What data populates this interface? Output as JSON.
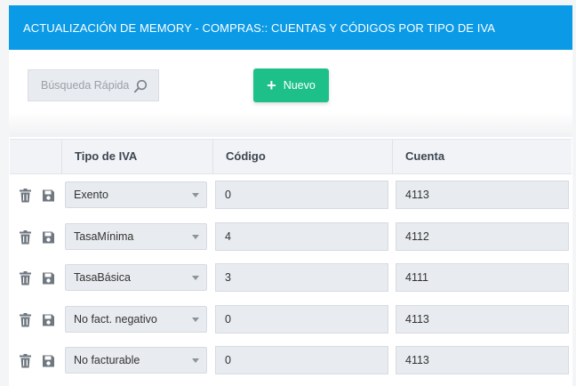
{
  "header": {
    "title": "ACTUALIZACIÓN DE MEMORY - COMPRAS:: CUENTAS Y CÓDIGOS POR TIPO DE IVA"
  },
  "toolbar": {
    "search_placeholder": "Búsqueda Rápida",
    "new_button_label": "Nuevo",
    "new_button_color": "#1ec08a"
  },
  "table": {
    "columns": [
      "Tipo de IVA",
      "Código",
      "Cuenta"
    ],
    "rows": [
      {
        "tipo": "Exento",
        "codigo": "0",
        "cuenta": "4113"
      },
      {
        "tipo": "TasaMínima",
        "codigo": "4",
        "cuenta": "4112"
      },
      {
        "tipo": "TasaBásica",
        "codigo": "3",
        "cuenta": "4111"
      },
      {
        "tipo": "No fact. negativo",
        "codigo": "0",
        "cuenta": "4113"
      },
      {
        "tipo": "No facturable",
        "codigo": "0",
        "cuenta": "4113"
      }
    ]
  },
  "icons": {
    "delete": "trash-icon",
    "save": "save-icon",
    "search": "search-icon",
    "add": "plus-icon"
  },
  "colors": {
    "header_bg": "#0a9ae6",
    "icon": "#6f7780"
  }
}
